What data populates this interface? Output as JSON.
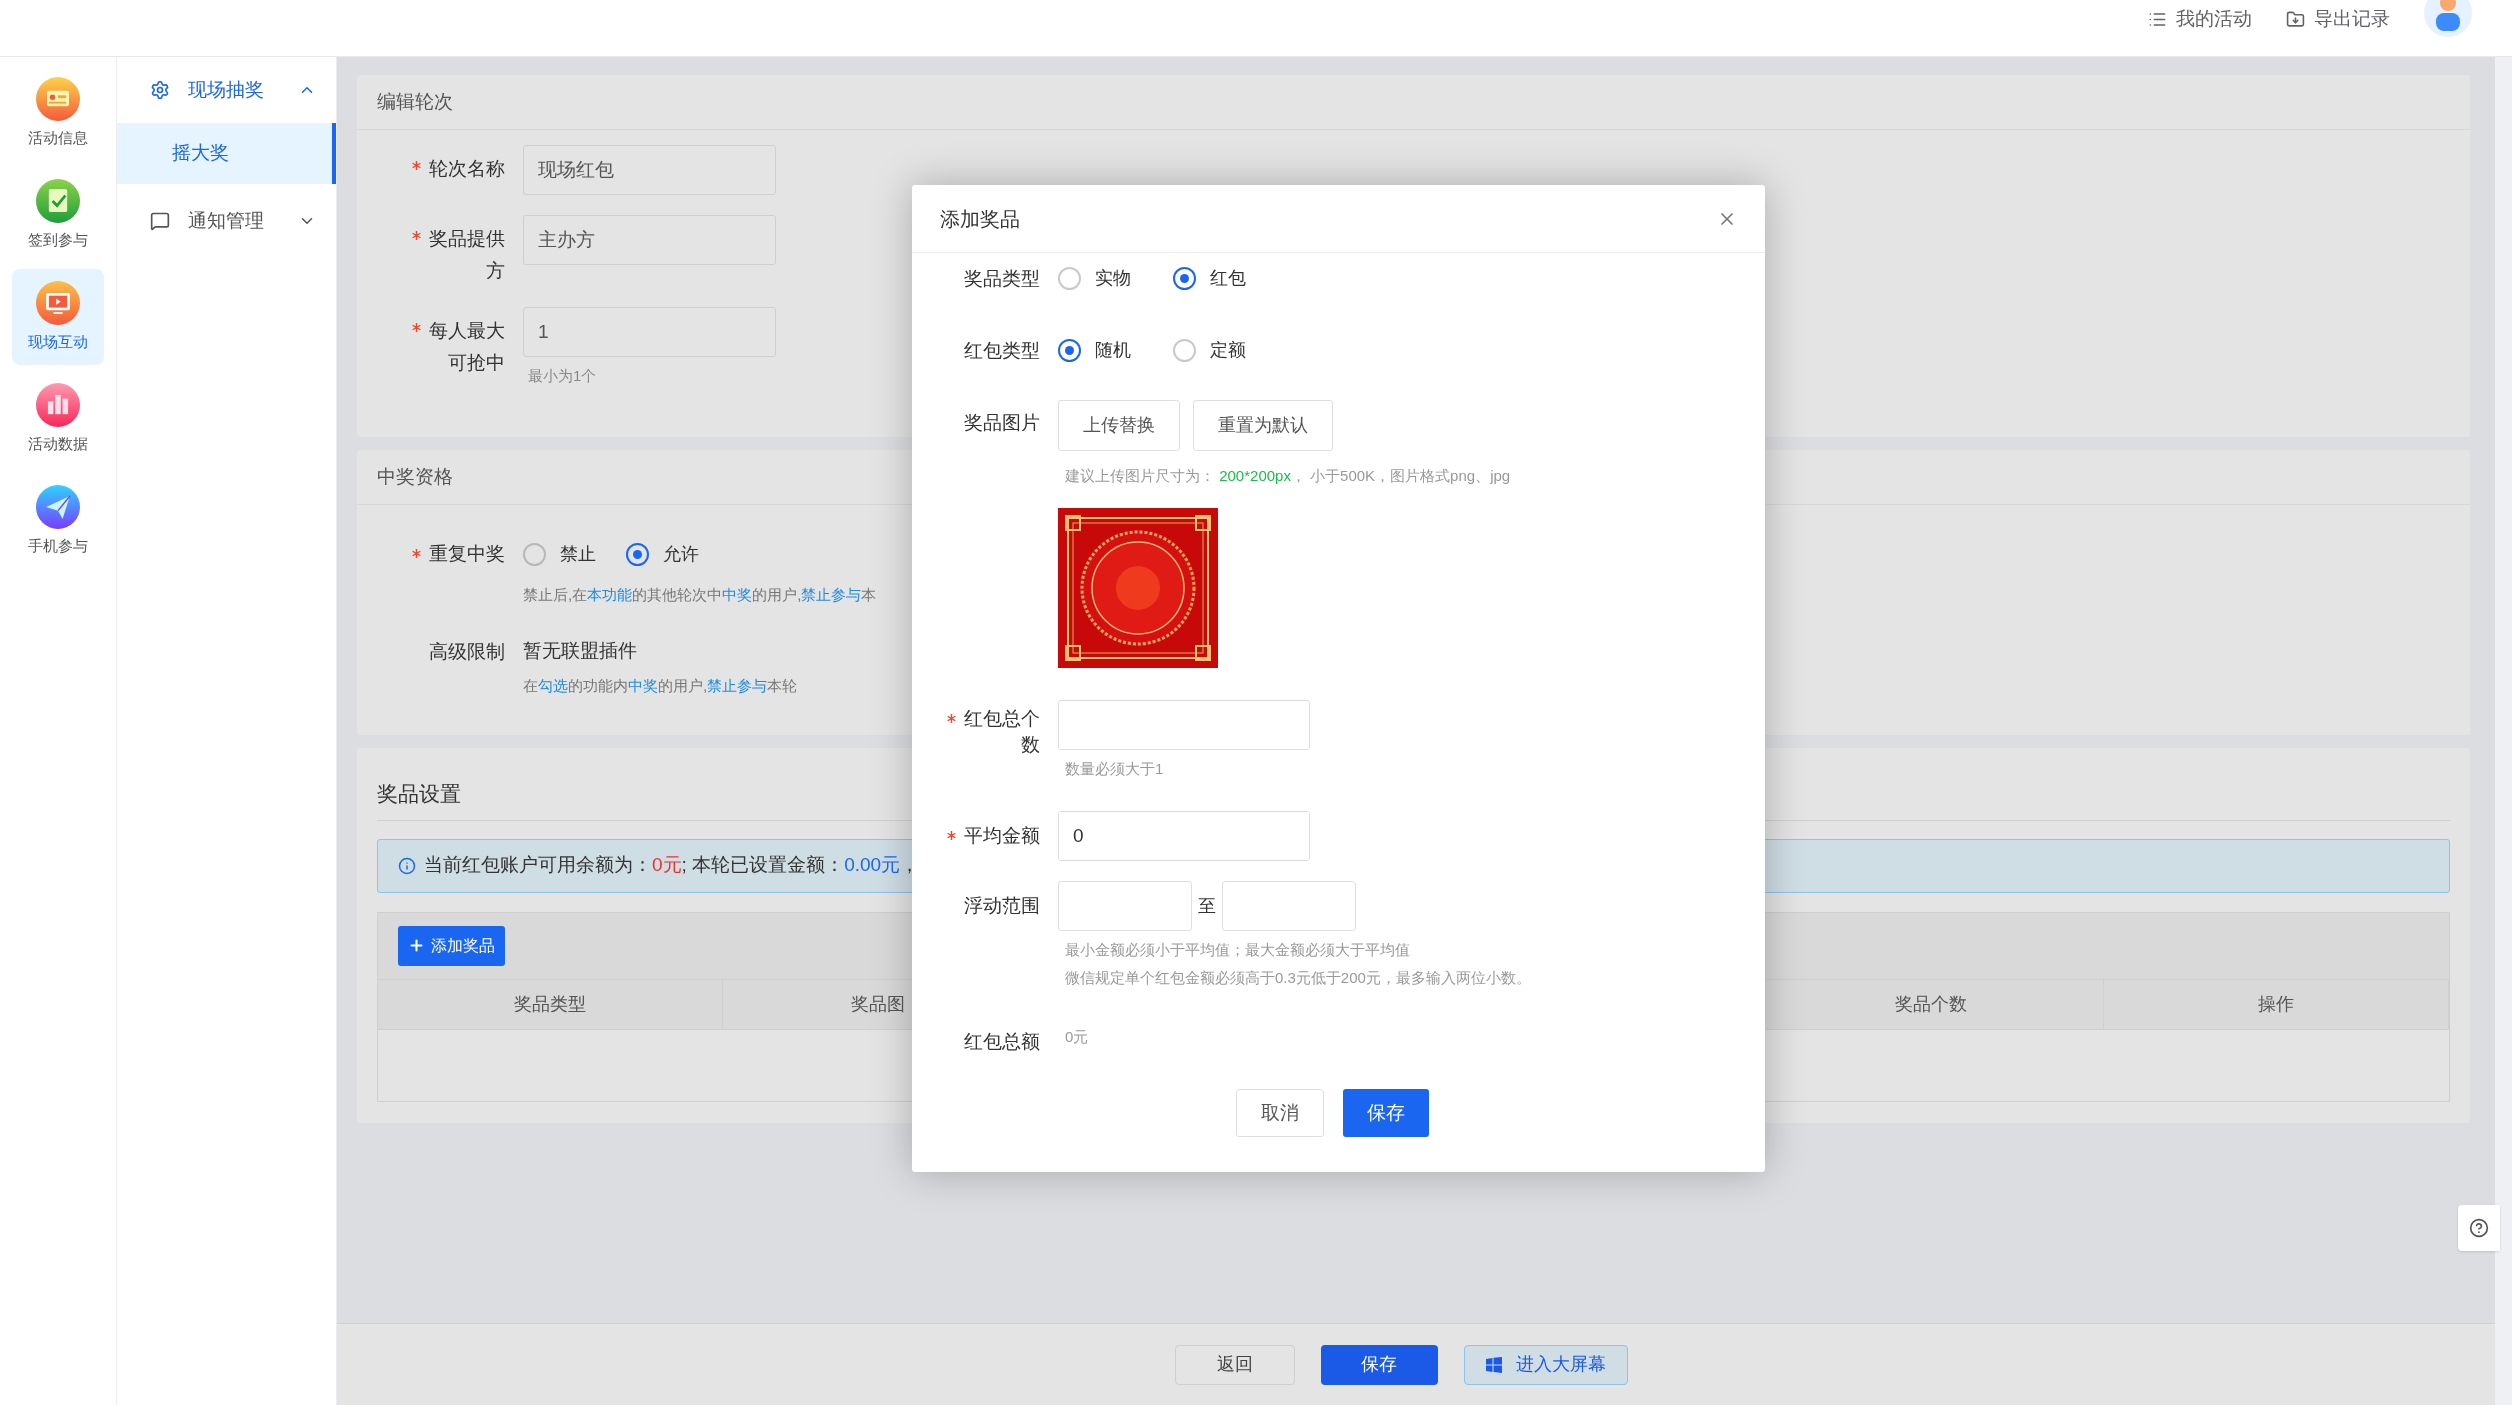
{
  "top_bar": {
    "links": [
      {
        "label": "我的活动"
      },
      {
        "label": "导出记录"
      }
    ]
  },
  "icon_rail": [
    {
      "label": "活动信息",
      "selected": false
    },
    {
      "label": "签到参与",
      "selected": false
    },
    {
      "label": "现场互动",
      "selected": true
    },
    {
      "label": "活动数据",
      "selected": false
    },
    {
      "label": "手机参与",
      "selected": false
    }
  ],
  "side_menu": [
    {
      "label": "现场抽奖",
      "selected": true,
      "expanded": true,
      "children": [
        {
          "label": "摇大奖",
          "selected": true
        }
      ]
    },
    {
      "label": "通知管理",
      "selected": false,
      "expanded": false
    }
  ],
  "edit_round": {
    "title": "编辑轮次",
    "fields": [
      {
        "label": "轮次名称",
        "required": true,
        "value": "现场红包"
      },
      {
        "label": "奖品提供方",
        "required": true,
        "value": "主办方"
      },
      {
        "label": "每人最大可抢中",
        "required": true,
        "value": "1",
        "hint": "最小为1个"
      }
    ]
  },
  "eligibility": {
    "title": "中奖资格",
    "repeat": {
      "label": "重复中奖",
      "required": true,
      "options": [
        {
          "label": "禁止",
          "selected": false
        },
        {
          "label": "允许",
          "selected": true
        }
      ],
      "hint": [
        {
          "text": "禁止后,在"
        },
        {
          "text": "本功能",
          "color": "#1f8ae6"
        },
        {
          "text": "的其他轮次中"
        },
        {
          "text": "中奖",
          "color": "#1f8ae6"
        },
        {
          "text": "的用户,"
        },
        {
          "text": "禁止参与",
          "color": "#1f8ae6"
        },
        {
          "text": "本"
        }
      ]
    },
    "advanced": {
      "label": "高级限制",
      "value": "暂无联盟插件",
      "hint": [
        {
          "text": "在"
        },
        {
          "text": "勾选",
          "color": "#1f8ae6"
        },
        {
          "text": "的功能内"
        },
        {
          "text": "中奖",
          "color": "#1f8ae6"
        },
        {
          "text": "的用户,"
        },
        {
          "text": "禁止参与",
          "color": "#1f8ae6"
        },
        {
          "text": "本轮"
        }
      ]
    }
  },
  "prize_settings": {
    "title": "奖品设置",
    "notice": [
      {
        "text": "当前红包账户可用余额为："
      },
      {
        "text": "0元",
        "color": "#f0312b"
      },
      {
        "text": "; 本轮已设置金额："
      },
      {
        "text": "0.00元",
        "color": "#1a66f0"
      },
      {
        "text": "，"
      }
    ],
    "add_button": "添加奖品",
    "columns": [
      {
        "label": "奖品类型"
      },
      {
        "label": "奖品图"
      },
      {
        "label": "奖品个数"
      },
      {
        "label": "操作"
      }
    ]
  },
  "footer_buttons": [
    {
      "label": "返回",
      "kind": "plain"
    },
    {
      "label": "保存",
      "kind": "primary"
    },
    {
      "label": "进入大屏幕",
      "kind": "screen"
    }
  ],
  "dialog": {
    "title": "添加奖品",
    "prize_type": {
      "label": "奖品类型",
      "options": [
        {
          "label": "实物",
          "selected": false
        },
        {
          "label": "红包",
          "selected": true
        }
      ]
    },
    "packet_type": {
      "label": "红包类型",
      "options": [
        {
          "label": "随机",
          "selected": true
        },
        {
          "label": "定额",
          "selected": false
        }
      ]
    },
    "image": {
      "label": "奖品图片",
      "buttons": [
        "上传替换",
        "重置为默认"
      ],
      "hint": [
        {
          "text": "建议上传图片尺寸为： "
        },
        {
          "text": "200*200px",
          "color": "#19be4b"
        },
        {
          "text": "，  小于500K，图片格式png、jpg"
        }
      ]
    },
    "total_count": {
      "label": "红包总个数",
      "required": true,
      "hint": "数量必须大于1"
    },
    "average": {
      "label": "平均金额",
      "required": true,
      "value": "0"
    },
    "range": {
      "label": "浮动范围",
      "separator": "至",
      "hints": [
        "最小金额必须小于平均值；最大金额必须大于平均值",
        "微信规定单个红包金额必须高于0.3元低于200元，最多输入两位小数。"
      ]
    },
    "total": {
      "label": "红包总额",
      "value": "0元"
    },
    "buttons": [
      {
        "label": "取消",
        "primary": false
      },
      {
        "label": "保存",
        "primary": true
      }
    ]
  }
}
